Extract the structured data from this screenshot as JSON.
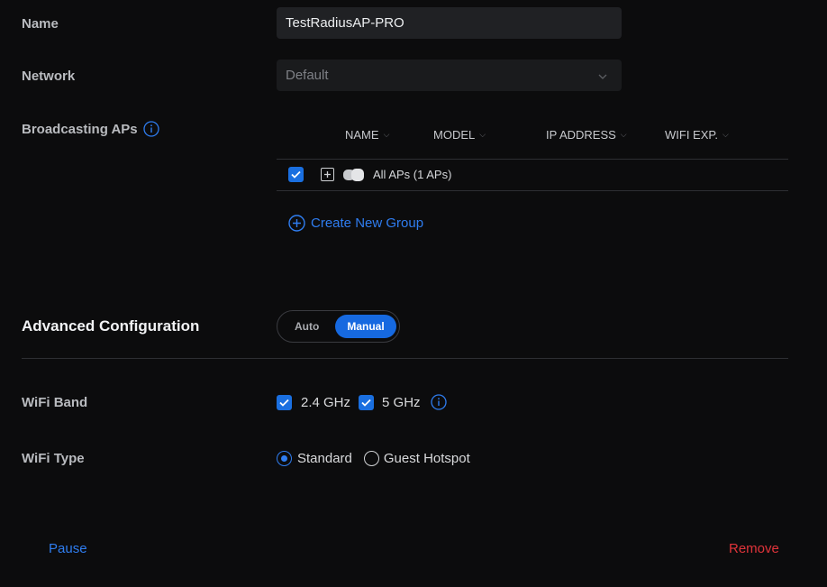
{
  "form": {
    "name_label": "Name",
    "name_value": "TestRadiusAP-PRO",
    "network_label": "Network",
    "network_value": "Default",
    "broadcasting_label": "Broadcasting APs"
  },
  "ap_table": {
    "columns": [
      "NAME",
      "MODEL",
      "IP ADDRESS",
      "WIFI EXP."
    ],
    "row_label": "All APs (1 APs)",
    "row_checked": true,
    "create_group_label": "Create New Group"
  },
  "advanced": {
    "title": "Advanced Configuration",
    "mode_options": [
      "Auto",
      "Manual"
    ],
    "selected_mode": "Manual"
  },
  "wifi_band": {
    "label": "WiFi Band",
    "options": [
      {
        "label": "2.4 GHz",
        "checked": true
      },
      {
        "label": "5 GHz",
        "checked": true
      }
    ]
  },
  "wifi_type": {
    "label": "WiFi Type",
    "options": [
      {
        "label": "Standard",
        "selected": true
      },
      {
        "label": "Guest Hotspot",
        "selected": false
      }
    ]
  },
  "footer": {
    "pause_label": "Pause",
    "remove_label": "Remove"
  },
  "colors": {
    "accent": "#2f7df0",
    "danger": "#e0343a",
    "background": "#0c0c0d"
  }
}
